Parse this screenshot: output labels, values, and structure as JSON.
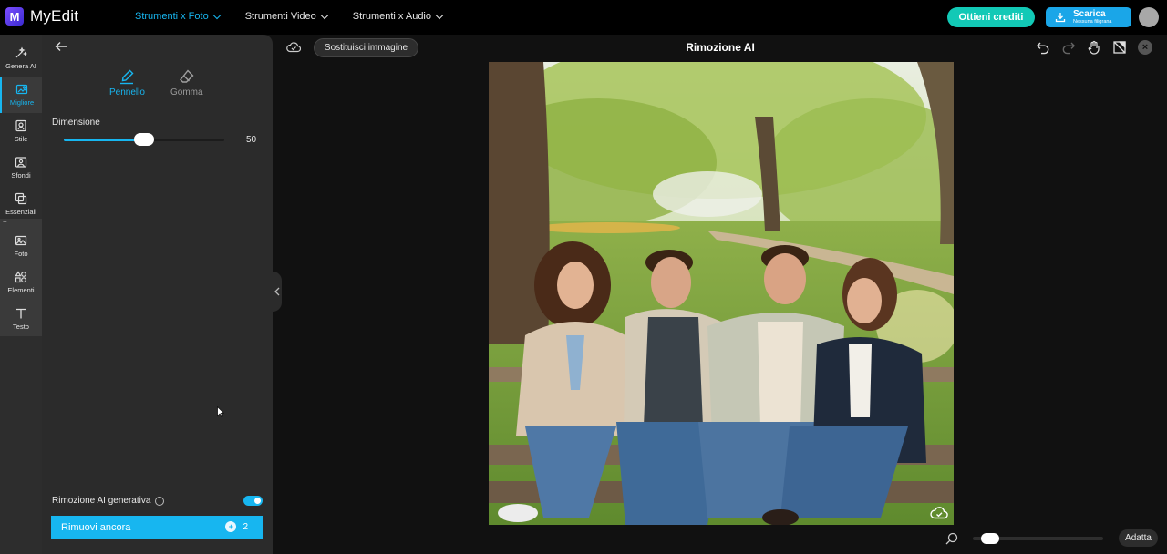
{
  "app": {
    "logo_letter": "M",
    "name": "MyEdit"
  },
  "nav": {
    "items": [
      {
        "label": "Strumenti x Foto",
        "active": true
      },
      {
        "label": "Strumenti Video",
        "active": false
      },
      {
        "label": "Strumenti x Audio",
        "active": false
      }
    ]
  },
  "header": {
    "credits_label": "Ottieni crediti",
    "download_label": "Scarica",
    "download_sub": "Nessuna filigrana"
  },
  "rail": {
    "items": [
      {
        "label": "Genera AI",
        "icon": "wand-icon"
      },
      {
        "label": "Migliore",
        "icon": "enhance-icon",
        "active": true
      },
      {
        "label": "Stile",
        "icon": "style-icon"
      },
      {
        "label": "Sfondi",
        "icon": "background-icon"
      },
      {
        "label": "Essenziali",
        "icon": "crop-icon"
      },
      {
        "label": "Foto",
        "icon": "photo-icon"
      },
      {
        "label": "Elementi",
        "icon": "shapes-icon"
      },
      {
        "label": "Testo",
        "icon": "text-icon"
      }
    ],
    "plus": "+"
  },
  "panel": {
    "tools": {
      "brush": "Pennello",
      "eraser": "Gomma"
    },
    "size_label": "Dimensione",
    "size_value": "50",
    "size_fraction": 0.5,
    "generative_label": "Rimozione AI generativa",
    "generative_enabled": true,
    "remove_button": "Rimuovi ancora",
    "remove_cost": "2"
  },
  "canvas": {
    "replace_button": "Sostituisci immagine",
    "title": "Rimozione AI",
    "fit_button": "Adatta",
    "zoom_fraction": 0.07
  },
  "colors": {
    "accent": "#17b6f0",
    "credits": "#12c9b6",
    "download": "#1aa6e8"
  }
}
